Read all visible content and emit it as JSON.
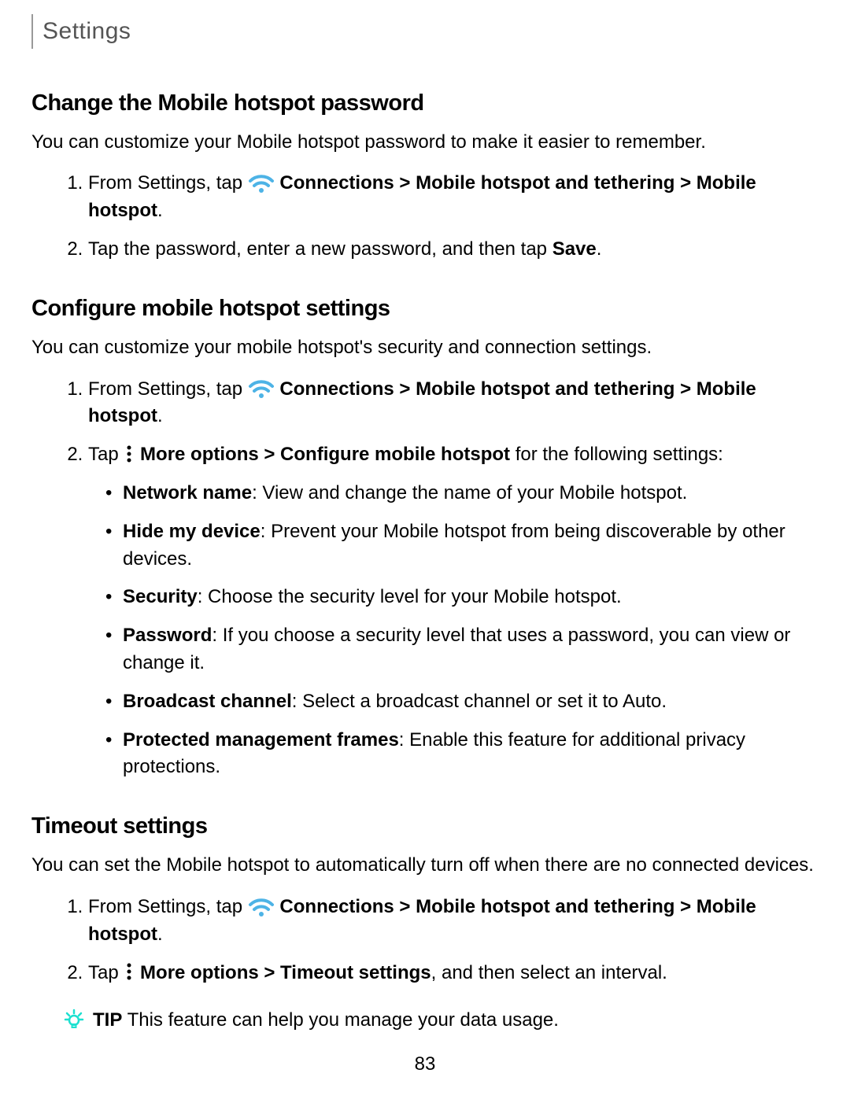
{
  "header": {
    "title": "Settings"
  },
  "page_number": "83",
  "common": {
    "from_settings_tap": "From Settings, tap ",
    "connections_path": "Connections > Mobile hotspot and tethering > Mobile hotspot",
    "period": ".",
    "more_options": "More options"
  },
  "section1": {
    "heading": "Change the Mobile hotspot password",
    "intro": "You can customize your Mobile hotspot password to make it easier to remember.",
    "step2_a": "Tap the password, enter a new password, and then tap ",
    "step2_b": "Save",
    "step2_c": "."
  },
  "section2": {
    "heading": "Configure mobile hotspot settings",
    "intro": "You can customize your mobile hotspot's security and connection settings.",
    "step2_a": "Tap ",
    "step2_b": " > Configure mobile hotspot",
    "step2_c": " for the following settings:",
    "bullets": [
      {
        "label": "Network name",
        "text": ": View and change the name of your Mobile hotspot."
      },
      {
        "label": "Hide my device",
        "text": ": Prevent your Mobile hotspot from being discoverable by other devices."
      },
      {
        "label": "Security",
        "text": ": Choose the security level for your Mobile hotspot."
      },
      {
        "label": "Password",
        "text": ": If you choose a security level that uses a password, you can view or change it."
      },
      {
        "label": "Broadcast channel",
        "text": ": Select a broadcast channel or set it to Auto."
      },
      {
        "label": "Protected management frames",
        "text": ": Enable this feature for additional privacy protections."
      }
    ]
  },
  "section3": {
    "heading": "Timeout settings",
    "intro": "You can set the Mobile hotspot to automatically turn off when there are no connected devices.",
    "step2_a": "Tap ",
    "step2_b": " > Timeout settings",
    "step2_c": ", and then select an interval."
  },
  "tip": {
    "label": "TIP",
    "text": " This feature can help you manage your data usage."
  }
}
